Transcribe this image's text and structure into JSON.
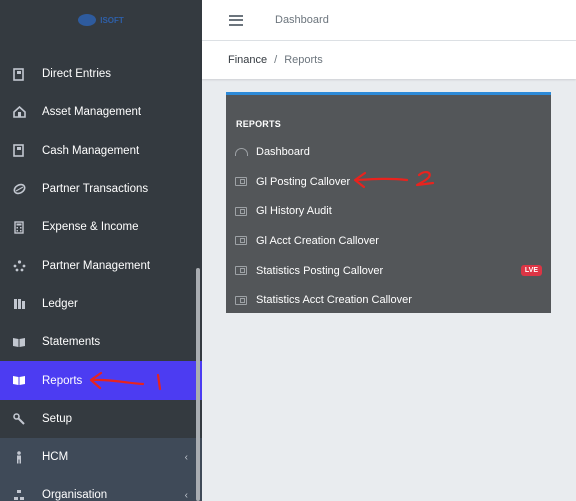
{
  "brand": {
    "logo_text": "ISOFT"
  },
  "sidebar": {
    "items": [
      {
        "label": "Direct Entries",
        "icon": "book-icon"
      },
      {
        "label": "Asset Management",
        "icon": "building-icon"
      },
      {
        "label": "Cash Management",
        "icon": "book-icon"
      },
      {
        "label": "Partner Transactions",
        "icon": "coins-icon"
      },
      {
        "label": "Expense & Income",
        "icon": "calculator-icon"
      },
      {
        "label": "Partner Management",
        "icon": "sitemap-icon"
      },
      {
        "label": "Ledger",
        "icon": "ledger-icon"
      },
      {
        "label": "Statements",
        "icon": "open-book-icon"
      },
      {
        "label": "Reports",
        "icon": "open-book-icon",
        "active": true
      },
      {
        "label": "Setup",
        "icon": "wrench-icon"
      },
      {
        "label": "HCM",
        "icon": "person-icon",
        "chevron": "‹"
      },
      {
        "label": "Organisation",
        "icon": "org-icon",
        "chevron": "‹"
      }
    ]
  },
  "header": {
    "nav_link": "Dashboard"
  },
  "breadcrumb": {
    "parent": "Finance",
    "separator": "/",
    "current": "Reports"
  },
  "reports": {
    "title": "REPORTS",
    "items": [
      {
        "label": "Dashboard"
      },
      {
        "label": "Gl Posting Callover"
      },
      {
        "label": "Gl History Audit"
      },
      {
        "label": "Gl Acct Creation Callover"
      },
      {
        "label": "Statistics Posting Callover",
        "badge": "LVE"
      },
      {
        "label": "Statistics Acct Creation Callover"
      }
    ]
  },
  "annotations": {
    "mark_1": "1",
    "mark_2": "2"
  },
  "colors": {
    "sidebar": "#343a40",
    "active": "#4c3cf2",
    "panel": "#535659",
    "panel_accent": "#2d8ad8",
    "badge": "#dc3545",
    "annotation": "#e8231e"
  }
}
